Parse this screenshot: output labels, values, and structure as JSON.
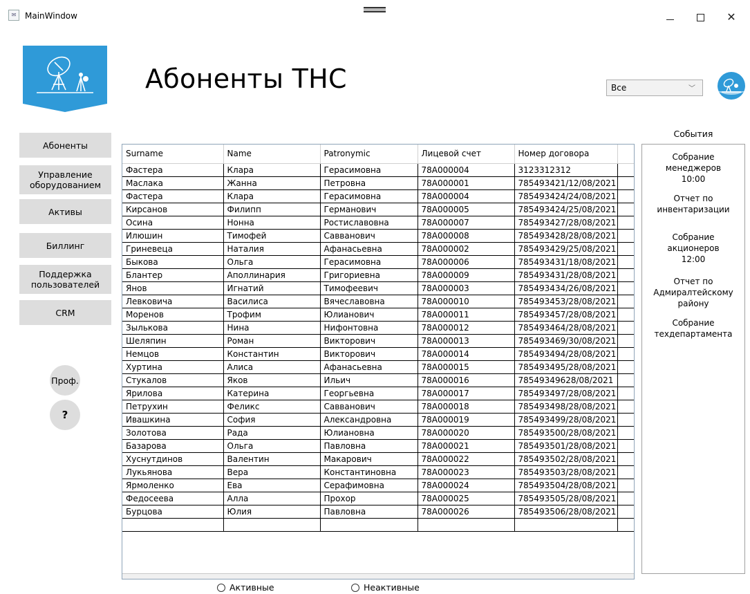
{
  "window": {
    "title": "MainWindow",
    "min_glyph": "—",
    "max_glyph": "☐",
    "close_glyph": "✕"
  },
  "header": {
    "title": "Абоненты ТНС"
  },
  "filter": {
    "selected": "Все"
  },
  "sidebar": {
    "items": [
      {
        "label": "Абоненты"
      },
      {
        "label": "Управление оборудованием"
      },
      {
        "label": "Активы"
      },
      {
        "label": "Биллинг"
      },
      {
        "label": "Поддержка пользователей"
      },
      {
        "label": "CRM"
      }
    ],
    "profile_label": "Проф.",
    "help_label": "?"
  },
  "grid": {
    "columns": [
      "Surname",
      "Name",
      "Patronymic",
      "Лицевой счет",
      "Номер договора"
    ],
    "rows": [
      [
        "Фастера",
        "Клара",
        "Герасимовна",
        "78A000004",
        "3123312312"
      ],
      [
        "Маслака",
        "Жанна",
        "Петровна",
        "78A000001",
        "785493421/12/08/2021"
      ],
      [
        "Фастера",
        "Клара",
        "Герасимовна",
        "78A000004",
        "785493424/24/08/2021"
      ],
      [
        "Кирсанов",
        "Филипп",
        "Германович",
        "78A000005",
        "785493424/25/08/2021"
      ],
      [
        "Осина",
        "Нонна",
        "Ростиславовна",
        "78A000007",
        "785493427/28/08/2021"
      ],
      [
        "Илюшин",
        "Тимофей",
        "Савванович",
        "78A000008",
        "785493428/28/08/2021"
      ],
      [
        "Гриневеца",
        "Наталия",
        "Афанасьевна",
        "78A000002",
        "785493429/25/08/2021"
      ],
      [
        "Быкова",
        "Ольга",
        "Герасимовна",
        "78A000006",
        "785493431/18/08/2021"
      ],
      [
        "Блантер",
        "Аполлинария",
        "Григориевна",
        "78A000009",
        "785493431/28/08/2021"
      ],
      [
        "Янов",
        "Игнатий",
        "Тимофеевич",
        "78A000003",
        "785493434/26/08/2021"
      ],
      [
        "Левковича",
        "Василиса",
        "Вячеславовна",
        "78A000010",
        "785493453/28/08/2021"
      ],
      [
        "Моренов",
        "Трофим",
        "Юлианович",
        "78A000011",
        "785493457/28/08/2021"
      ],
      [
        "Зылькова",
        "Нина",
        "Нифонтовна",
        "78A000012",
        "785493464/28/08/2021"
      ],
      [
        "Шеляпин",
        "Роман",
        "Викторович",
        "78A000013",
        "785493469/30/08/2021"
      ],
      [
        "Немцов",
        "Константин",
        "Викторович",
        "78A000014",
        "785493494/28/08/2021"
      ],
      [
        "Хуртина",
        "Алиса",
        "Афанасьевна",
        "78A000015",
        "785493495/28/08/2021"
      ],
      [
        "Стукалов",
        "Яков",
        "Ильич",
        "78A000016",
        "78549349628/08/2021"
      ],
      [
        "Ярилова",
        "Катерина",
        "Георгьевна",
        "78A000017",
        "785493497/28/08/2021"
      ],
      [
        "Петрухин",
        "Феликс",
        "Савванович",
        "78A000018",
        "785493498/28/08/2021"
      ],
      [
        "Ивашкина",
        "София",
        "Александровна",
        "78A000019",
        "785493499/28/08/2021"
      ],
      [
        "Золотова",
        "Рада",
        "Юлиановна",
        "78A000020",
        "785493500/28/08/2021"
      ],
      [
        "Базарова",
        "Ольга",
        "Павловна",
        "78A000021",
        "785493501/28/08/2021"
      ],
      [
        "Хуснутдинов",
        "Валентин",
        "Макарович",
        "78A000022",
        "785493502/28/08/2021"
      ],
      [
        "Лукьянова",
        "Вера",
        "Константиновна",
        "78A000023",
        "785493503/28/08/2021"
      ],
      [
        "Ярмоленко",
        "Ева",
        "Серафимовна",
        "78A000024",
        "785493504/28/08/2021"
      ],
      [
        "Федосеева",
        "Алла",
        "Прохор",
        "78A000025",
        "785493505/28/08/2021"
      ],
      [
        "Бурцова",
        "Юлия",
        "Павловна",
        "78A000026",
        "785493506/28/08/2021"
      ]
    ]
  },
  "radios": {
    "active": "Активные",
    "inactive": "Неактивные"
  },
  "events": {
    "title": "События",
    "items": [
      "Собрание\nменеджеров\n10:00",
      "Отчет по\nинвентаризации",
      "Собрание\nакционеров\n12:00",
      "Отчет по\nАдмиралтейскому\nрайону",
      "Собрание\nтехдепартамента"
    ]
  },
  "colors": {
    "logo_blue": "#2f9ad8",
    "sidebar_button": "#dddddd"
  }
}
